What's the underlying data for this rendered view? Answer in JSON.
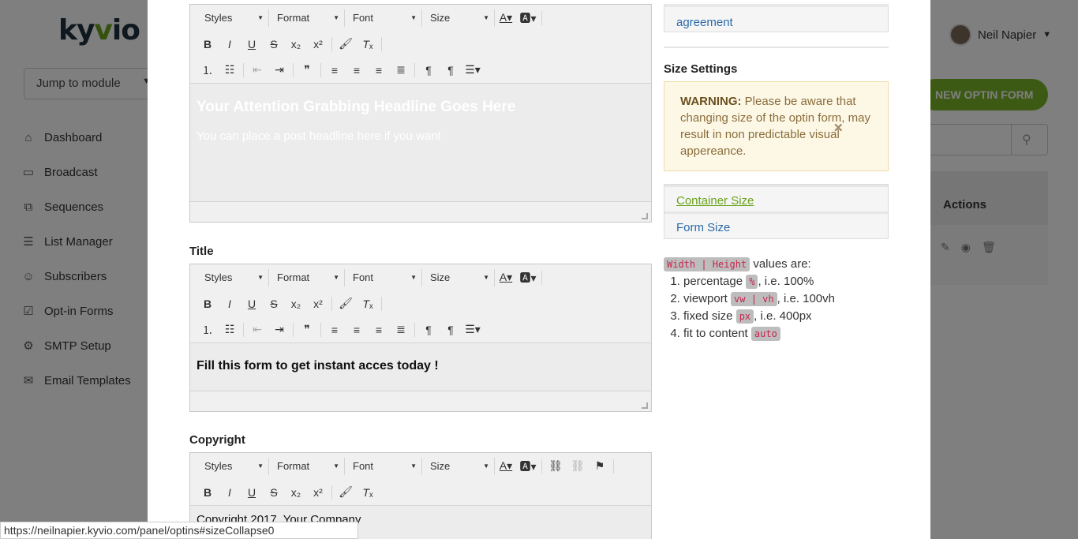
{
  "app": {
    "logo": {
      "prefix": "ky",
      "accent": "v",
      "suffix": "io"
    },
    "jump_to_module": "Jump to module",
    "user_name": "Neil Napier",
    "new_optin_label": "NEW OPTIN FORM",
    "table_actions_header": "Actions",
    "sidebar": [
      {
        "label": "Dashboard",
        "icon": "home-icon"
      },
      {
        "label": "Broadcast",
        "icon": "briefcase-icon"
      },
      {
        "label": "Sequences",
        "icon": "sequence-icon"
      },
      {
        "label": "List Manager",
        "icon": "list-icon"
      },
      {
        "label": "Subscribers",
        "icon": "users-icon"
      },
      {
        "label": "Opt-in Forms",
        "icon": "checkbox-icon"
      },
      {
        "label": "SMTP Setup",
        "icon": "gear-icon"
      },
      {
        "label": "Email Templates",
        "icon": "envelope-icon"
      }
    ]
  },
  "modal": {
    "editor_toolbar": {
      "styles": "Styles",
      "format": "Format",
      "font": "Font",
      "size": "Size"
    },
    "headline_editor": {
      "headline": "Your Attention Grabbing Headline Goes Here",
      "subheadline": "You can place a post headline here if you want"
    },
    "title_section": {
      "label": "Title",
      "content": "Fill this form to get instant acces today !"
    },
    "copyright_section": {
      "label": "Copyright",
      "content_partial": "Copyright 2017. Your Company"
    },
    "right_panel": {
      "agreement_link": "agreement",
      "size_settings_title": "Size Settings",
      "warning_strong": "WARNING:",
      "warning_text": " Please be aware that changing size of the optin form, may result in non predictable visual appereance.",
      "accordion": [
        "Container Size",
        "Form Size"
      ],
      "values_code": "Width | Height",
      "values_are": " values are:",
      "list": [
        {
          "pre": "percentage ",
          "code": "%",
          "post": ", i.e. 100%"
        },
        {
          "pre": "viewport ",
          "code": "vw | vh",
          "post": ", i.e. 100vh"
        },
        {
          "pre": "fixed size ",
          "code": "px",
          "post": ", i.e. 400px"
        },
        {
          "pre": "fit to content ",
          "code": "auto",
          "post": ""
        }
      ]
    }
  },
  "status_url": "https://neilnapier.kyvio.com/panel/optins#sizeCollapse0",
  "colors": {
    "accent_green": "#7bb42a",
    "link_blue": "#2a6aa8",
    "warning_bg": "#fdf8e6"
  }
}
